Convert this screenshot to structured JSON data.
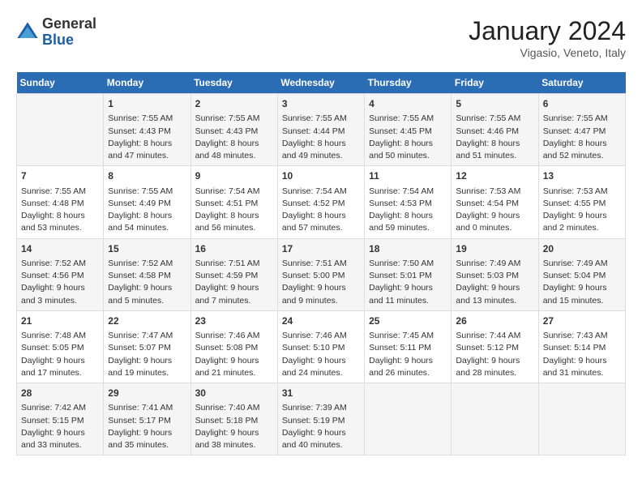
{
  "logo": {
    "general": "General",
    "blue": "Blue"
  },
  "title": "January 2024",
  "location": "Vigasio, Veneto, Italy",
  "days_of_week": [
    "Sunday",
    "Monday",
    "Tuesday",
    "Wednesday",
    "Thursday",
    "Friday",
    "Saturday"
  ],
  "weeks": [
    [
      {
        "day": "",
        "sunrise": "",
        "sunset": "",
        "daylight": ""
      },
      {
        "day": "1",
        "sunrise": "Sunrise: 7:55 AM",
        "sunset": "Sunset: 4:43 PM",
        "daylight": "Daylight: 8 hours and 47 minutes."
      },
      {
        "day": "2",
        "sunrise": "Sunrise: 7:55 AM",
        "sunset": "Sunset: 4:43 PM",
        "daylight": "Daylight: 8 hours and 48 minutes."
      },
      {
        "day": "3",
        "sunrise": "Sunrise: 7:55 AM",
        "sunset": "Sunset: 4:44 PM",
        "daylight": "Daylight: 8 hours and 49 minutes."
      },
      {
        "day": "4",
        "sunrise": "Sunrise: 7:55 AM",
        "sunset": "Sunset: 4:45 PM",
        "daylight": "Daylight: 8 hours and 50 minutes."
      },
      {
        "day": "5",
        "sunrise": "Sunrise: 7:55 AM",
        "sunset": "Sunset: 4:46 PM",
        "daylight": "Daylight: 8 hours and 51 minutes."
      },
      {
        "day": "6",
        "sunrise": "Sunrise: 7:55 AM",
        "sunset": "Sunset: 4:47 PM",
        "daylight": "Daylight: 8 hours and 52 minutes."
      }
    ],
    [
      {
        "day": "7",
        "sunrise": "Sunrise: 7:55 AM",
        "sunset": "Sunset: 4:48 PM",
        "daylight": "Daylight: 8 hours and 53 minutes."
      },
      {
        "day": "8",
        "sunrise": "Sunrise: 7:55 AM",
        "sunset": "Sunset: 4:49 PM",
        "daylight": "Daylight: 8 hours and 54 minutes."
      },
      {
        "day": "9",
        "sunrise": "Sunrise: 7:54 AM",
        "sunset": "Sunset: 4:51 PM",
        "daylight": "Daylight: 8 hours and 56 minutes."
      },
      {
        "day": "10",
        "sunrise": "Sunrise: 7:54 AM",
        "sunset": "Sunset: 4:52 PM",
        "daylight": "Daylight: 8 hours and 57 minutes."
      },
      {
        "day": "11",
        "sunrise": "Sunrise: 7:54 AM",
        "sunset": "Sunset: 4:53 PM",
        "daylight": "Daylight: 8 hours and 59 minutes."
      },
      {
        "day": "12",
        "sunrise": "Sunrise: 7:53 AM",
        "sunset": "Sunset: 4:54 PM",
        "daylight": "Daylight: 9 hours and 0 minutes."
      },
      {
        "day": "13",
        "sunrise": "Sunrise: 7:53 AM",
        "sunset": "Sunset: 4:55 PM",
        "daylight": "Daylight: 9 hours and 2 minutes."
      }
    ],
    [
      {
        "day": "14",
        "sunrise": "Sunrise: 7:52 AM",
        "sunset": "Sunset: 4:56 PM",
        "daylight": "Daylight: 9 hours and 3 minutes."
      },
      {
        "day": "15",
        "sunrise": "Sunrise: 7:52 AM",
        "sunset": "Sunset: 4:58 PM",
        "daylight": "Daylight: 9 hours and 5 minutes."
      },
      {
        "day": "16",
        "sunrise": "Sunrise: 7:51 AM",
        "sunset": "Sunset: 4:59 PM",
        "daylight": "Daylight: 9 hours and 7 minutes."
      },
      {
        "day": "17",
        "sunrise": "Sunrise: 7:51 AM",
        "sunset": "Sunset: 5:00 PM",
        "daylight": "Daylight: 9 hours and 9 minutes."
      },
      {
        "day": "18",
        "sunrise": "Sunrise: 7:50 AM",
        "sunset": "Sunset: 5:01 PM",
        "daylight": "Daylight: 9 hours and 11 minutes."
      },
      {
        "day": "19",
        "sunrise": "Sunrise: 7:49 AM",
        "sunset": "Sunset: 5:03 PM",
        "daylight": "Daylight: 9 hours and 13 minutes."
      },
      {
        "day": "20",
        "sunrise": "Sunrise: 7:49 AM",
        "sunset": "Sunset: 5:04 PM",
        "daylight": "Daylight: 9 hours and 15 minutes."
      }
    ],
    [
      {
        "day": "21",
        "sunrise": "Sunrise: 7:48 AM",
        "sunset": "Sunset: 5:05 PM",
        "daylight": "Daylight: 9 hours and 17 minutes."
      },
      {
        "day": "22",
        "sunrise": "Sunrise: 7:47 AM",
        "sunset": "Sunset: 5:07 PM",
        "daylight": "Daylight: 9 hours and 19 minutes."
      },
      {
        "day": "23",
        "sunrise": "Sunrise: 7:46 AM",
        "sunset": "Sunset: 5:08 PM",
        "daylight": "Daylight: 9 hours and 21 minutes."
      },
      {
        "day": "24",
        "sunrise": "Sunrise: 7:46 AM",
        "sunset": "Sunset: 5:10 PM",
        "daylight": "Daylight: 9 hours and 24 minutes."
      },
      {
        "day": "25",
        "sunrise": "Sunrise: 7:45 AM",
        "sunset": "Sunset: 5:11 PM",
        "daylight": "Daylight: 9 hours and 26 minutes."
      },
      {
        "day": "26",
        "sunrise": "Sunrise: 7:44 AM",
        "sunset": "Sunset: 5:12 PM",
        "daylight": "Daylight: 9 hours and 28 minutes."
      },
      {
        "day": "27",
        "sunrise": "Sunrise: 7:43 AM",
        "sunset": "Sunset: 5:14 PM",
        "daylight": "Daylight: 9 hours and 31 minutes."
      }
    ],
    [
      {
        "day": "28",
        "sunrise": "Sunrise: 7:42 AM",
        "sunset": "Sunset: 5:15 PM",
        "daylight": "Daylight: 9 hours and 33 minutes."
      },
      {
        "day": "29",
        "sunrise": "Sunrise: 7:41 AM",
        "sunset": "Sunset: 5:17 PM",
        "daylight": "Daylight: 9 hours and 35 minutes."
      },
      {
        "day": "30",
        "sunrise": "Sunrise: 7:40 AM",
        "sunset": "Sunset: 5:18 PM",
        "daylight": "Daylight: 9 hours and 38 minutes."
      },
      {
        "day": "31",
        "sunrise": "Sunrise: 7:39 AM",
        "sunset": "Sunset: 5:19 PM",
        "daylight": "Daylight: 9 hours and 40 minutes."
      },
      {
        "day": "",
        "sunrise": "",
        "sunset": "",
        "daylight": ""
      },
      {
        "day": "",
        "sunrise": "",
        "sunset": "",
        "daylight": ""
      },
      {
        "day": "",
        "sunrise": "",
        "sunset": "",
        "daylight": ""
      }
    ]
  ]
}
